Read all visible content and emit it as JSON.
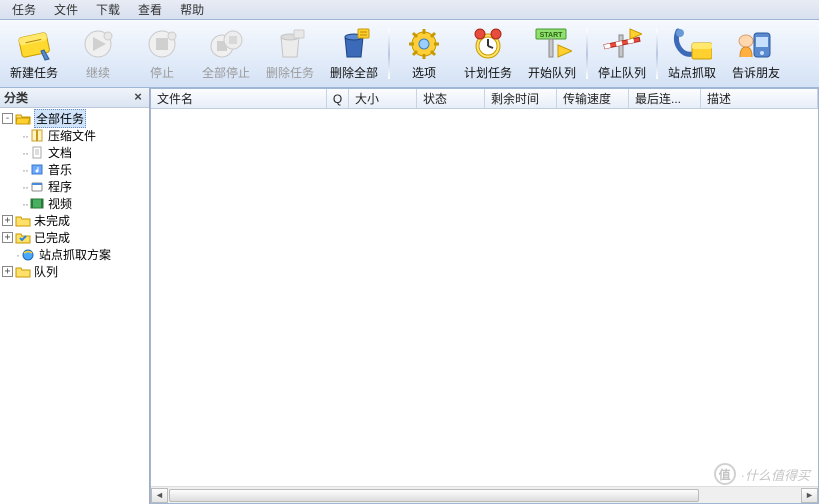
{
  "menu": {
    "items": [
      "任务",
      "文件",
      "下载",
      "查看",
      "帮助"
    ]
  },
  "toolbar": {
    "new_task": "新建任务",
    "resume": "继续",
    "stop": "停止",
    "stop_all": "全部停止",
    "delete": "删除任务",
    "delete_all": "删除全部",
    "options": "选项",
    "schedule": "计划任务",
    "start_queue": "开始队列",
    "stop_queue": "停止队列",
    "grabber": "站点抓取",
    "tell_friend": "告诉朋友"
  },
  "sidebar": {
    "title": "分类",
    "nodes": {
      "all": "全部任务",
      "compressed": "压缩文件",
      "documents": "文档",
      "music": "音乐",
      "programs": "程序",
      "video": "视频",
      "unfinished": "未完成",
      "finished": "已完成",
      "grabber": "站点抓取方案",
      "queue": "队列"
    }
  },
  "columns": {
    "filename": "文件名",
    "q": "Q",
    "size": "大小",
    "status": "状态",
    "time_left": "剩余时间",
    "speed": "传输速度",
    "last_try": "最后连...",
    "desc": "描述"
  },
  "watermark": {
    "badge": "值",
    "text": "·什么值得买"
  }
}
